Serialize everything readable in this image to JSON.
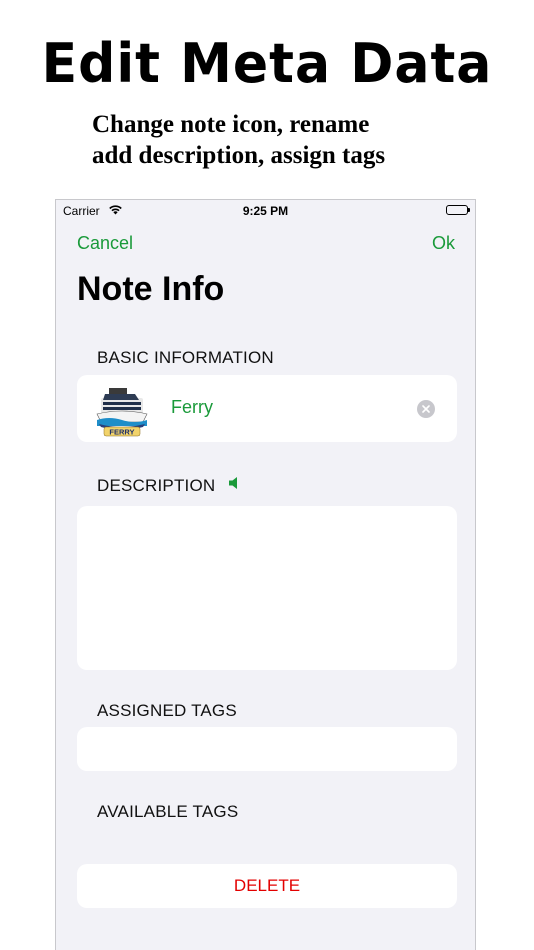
{
  "headline": "Edit Meta Data",
  "subtitle": {
    "line1": "Change note icon, rename",
    "line2": "add description, assign tags"
  },
  "status_bar": {
    "carrier": "Carrier",
    "time": "9:25 PM"
  },
  "nav": {
    "cancel_label": "Cancel",
    "ok_label": "Ok"
  },
  "page_title": "Note Info",
  "basic_info": {
    "header": "BASIC INFORMATION",
    "note_name": "Ferry",
    "icon": "ferry-logo-icon"
  },
  "description": {
    "header": "DESCRIPTION",
    "value": ""
  },
  "assigned_tags": {
    "header": "ASSIGNED TAGS",
    "items": []
  },
  "available_tags": {
    "header": "AVAILABLE TAGS",
    "items": []
  },
  "delete_label": "DELETE",
  "colors": {
    "accent": "#1a9a3a",
    "destructive": "#e30000",
    "background": "#f2f2f7"
  }
}
